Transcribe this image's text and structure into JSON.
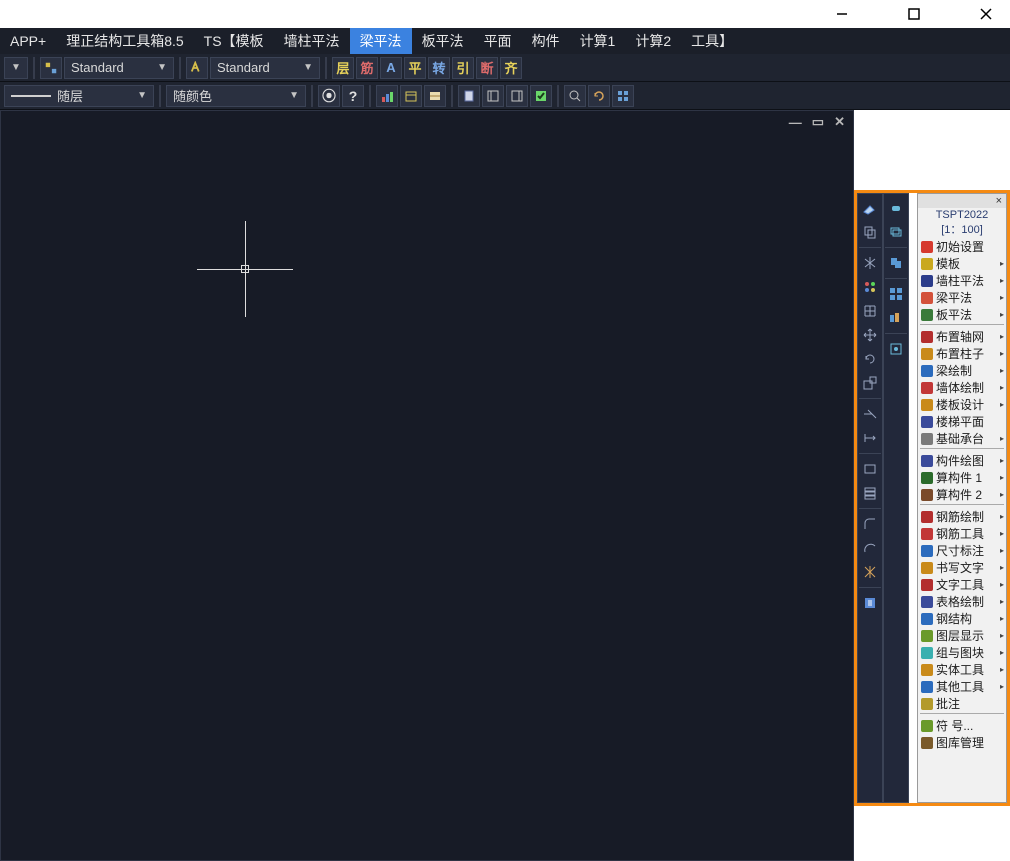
{
  "menubar": {
    "items": [
      {
        "label": "APP+"
      },
      {
        "label": "理正结构工具箱8.5"
      },
      {
        "label": "TS【模板"
      },
      {
        "label": "墙柱平法"
      },
      {
        "label": "梁平法",
        "active": true
      },
      {
        "label": "板平法"
      },
      {
        "label": "平面"
      },
      {
        "label": "构件"
      },
      {
        "label": "计算1"
      },
      {
        "label": "计算2"
      },
      {
        "label": "工具】"
      }
    ]
  },
  "toolbar1": {
    "style_select_1": "Standard",
    "style_select_2": "Standard",
    "glyphs": [
      "层",
      "筋",
      "A",
      "平",
      "转",
      "引",
      "断",
      "齐"
    ]
  },
  "toolbar2": {
    "layer_label": "随层",
    "color_label": "随颜色"
  },
  "side_panel": {
    "title_1": "TSPT2022",
    "title_2": "[1：100]",
    "items": [
      {
        "label": "初始设置",
        "arrow": false,
        "color": "#d63a2f"
      },
      {
        "label": "模板",
        "arrow": true,
        "color": "#c9a81e"
      },
      {
        "label": "墙柱平法",
        "arrow": true,
        "color": "#2b3c8a"
      },
      {
        "label": "梁平法",
        "arrow": true,
        "color": "#d3513a"
      },
      {
        "label": "板平法",
        "arrow": true,
        "color": "#3a7a3a"
      },
      {
        "label": "_divider"
      },
      {
        "label": "布置轴网",
        "arrow": true,
        "color": "#b32e2e"
      },
      {
        "label": "布置柱子",
        "arrow": true,
        "color": "#c98a1a"
      },
      {
        "label": "梁绘制",
        "arrow": true,
        "color": "#2b6bbd"
      },
      {
        "label": "墙体绘制",
        "arrow": true,
        "color": "#c23737"
      },
      {
        "label": "楼板设计",
        "arrow": true,
        "color": "#c98a1a"
      },
      {
        "label": "楼梯平面",
        "arrow": false,
        "color": "#3a4a9a"
      },
      {
        "label": "基础承台",
        "arrow": true,
        "color": "#7a7a7a"
      },
      {
        "label": "_divider"
      },
      {
        "label": "构件绘图",
        "arrow": true,
        "color": "#3a4a9a"
      },
      {
        "label": "算构件 1",
        "arrow": true,
        "color": "#2b6b2b"
      },
      {
        "label": "算构件 2",
        "arrow": true,
        "color": "#7a4a2a"
      },
      {
        "label": "_divider"
      },
      {
        "label": "钢筋绘制",
        "arrow": true,
        "color": "#b32e2e"
      },
      {
        "label": "钢筋工具",
        "arrow": true,
        "color": "#c23737"
      },
      {
        "label": "尺寸标注",
        "arrow": true,
        "color": "#2b6bbd"
      },
      {
        "label": "书写文字",
        "arrow": true,
        "color": "#c98a1a"
      },
      {
        "label": "文字工具",
        "arrow": true,
        "color": "#b32e2e"
      },
      {
        "label": "表格绘制",
        "arrow": true,
        "color": "#3a4a9a"
      },
      {
        "label": "钢结构",
        "arrow": true,
        "color": "#2b6bbd"
      },
      {
        "label": "图层显示",
        "arrow": true,
        "color": "#6a9a2a"
      },
      {
        "label": "组与图块",
        "arrow": true,
        "color": "#3ab0b0"
      },
      {
        "label": "实体工具",
        "arrow": true,
        "color": "#c98a1a"
      },
      {
        "label": "其他工具",
        "arrow": true,
        "color": "#2b6bbd"
      },
      {
        "label": "批注",
        "arrow": false,
        "color": "#b39a2a"
      },
      {
        "label": "_divider"
      },
      {
        "label": "符  号...",
        "arrow": false,
        "color": "#6a9a2a"
      },
      {
        "label": "图库管理",
        "arrow": false,
        "color": "#7a5a2a"
      }
    ]
  }
}
